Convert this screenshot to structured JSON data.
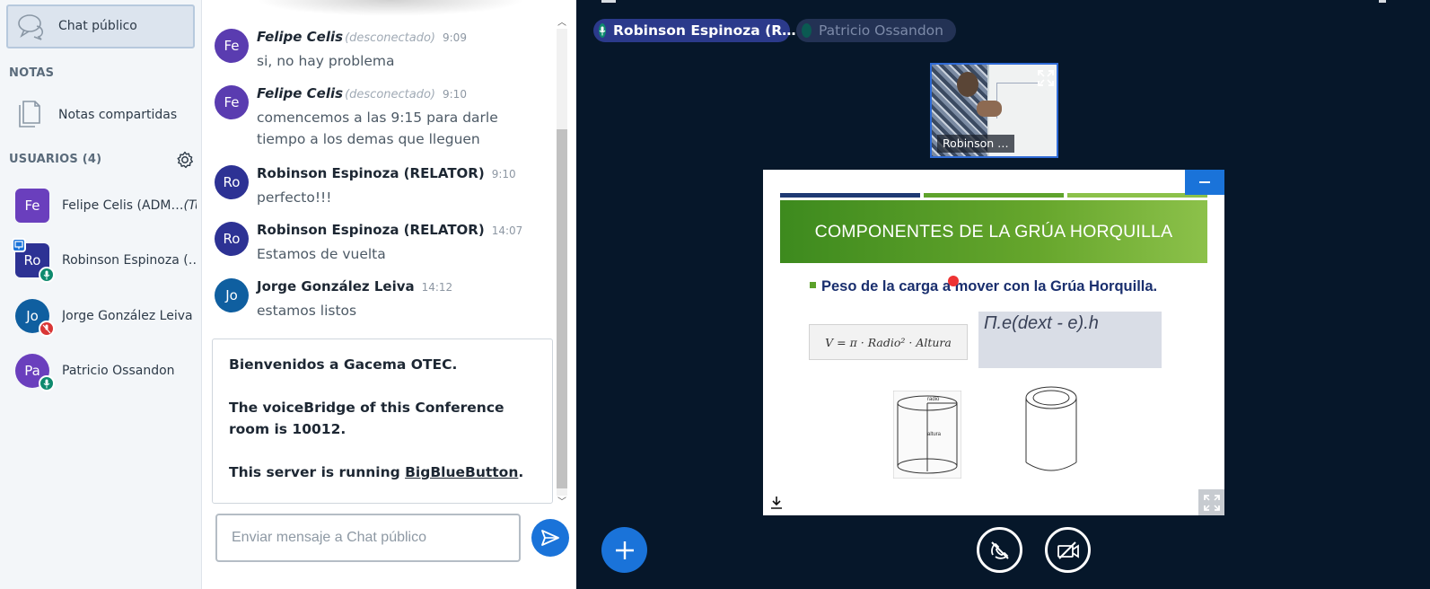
{
  "sidebar": {
    "chat_item_label": "Chat público",
    "notes_section_title": "NOTAS",
    "notes_item_label": "Notas compartidas",
    "users_section_title": "USUARIOS (4)",
    "users": [
      {
        "initials": "Fe",
        "name": "Felipe Celis (ADM…",
        "suffix": "(Tu)",
        "color": "#6a3fbd"
      },
      {
        "initials": "Ro",
        "name": "Robinson Espinoza (…",
        "suffix": "",
        "color": "#2d3294"
      },
      {
        "initials": "Jo",
        "name": "Jorge González Leiva",
        "suffix": "",
        "color": "#0f5fa0"
      },
      {
        "initials": "Pa",
        "name": "Patricio Ossandon",
        "suffix": "",
        "color": "#6a3fbd"
      }
    ]
  },
  "chat": {
    "messages": [
      {
        "initials": "Fe",
        "name": "Felipe Celis",
        "status": "(desconectado)",
        "time": "9:09",
        "text": "si, no hay problema",
        "color": "#5a3cb0"
      },
      {
        "initials": "Fe",
        "name": "Felipe Celis",
        "status": "(desconectado)",
        "time": "9:10",
        "text": "comencemos a las 9:15 para darle tiempo a los demas que lleguen",
        "color": "#5a3cb0"
      },
      {
        "initials": "Ro",
        "name": "Robinson Espinoza (RELATOR)",
        "status": "",
        "time": "9:10",
        "text": "perfecto!!!",
        "color": "#2d3294"
      },
      {
        "initials": "Ro",
        "name": "Robinson Espinoza (RELATOR)",
        "status": "",
        "time": "14:07",
        "text": "Estamos de vuelta",
        "color": "#2d3294"
      },
      {
        "initials": "Jo",
        "name": "Jorge González Leiva",
        "status": "",
        "time": "14:12",
        "text": "estamos listos",
        "color": "#0f5fa0"
      }
    ],
    "welcome": {
      "line1": "Bienvenidos a Gacema OTEC.",
      "line2": "The voiceBridge of this Conference room is 10012.",
      "line3_prefix": "This server is running ",
      "line3_link": "BigBlueButton",
      "line3_suffix": "."
    },
    "input_placeholder": "Enviar mensaje a Chat público"
  },
  "presentation": {
    "talkers": [
      "Robinson Espinoza (R…",
      "Patricio Ossandon"
    ],
    "video_name": "Robinson …",
    "slide": {
      "title": "COMPONENTES DE LA GRÚA HORQUILLA",
      "bullet": "Peso de la carga a mover con la Grúa Horquilla.",
      "formula": "V = π · Radio² · Altura",
      "formula2": "Π.e(dext - e).h",
      "cyl_label_top": "radio",
      "cyl_label_mid": "altura"
    }
  },
  "colors": {
    "accent": "#1a73d9",
    "background": "#06172a",
    "talker_active": "#2b3a8b",
    "talker_inactive": "#233254"
  },
  "icons": [
    "chat-icon",
    "notes-icon",
    "gear-icon",
    "presenter-icon",
    "mic-icon",
    "mic-muted-icon",
    "send-icon",
    "fullscreen-icon",
    "minimize-icon",
    "download-icon",
    "plus-icon",
    "audio-off-icon",
    "video-off-icon"
  ]
}
